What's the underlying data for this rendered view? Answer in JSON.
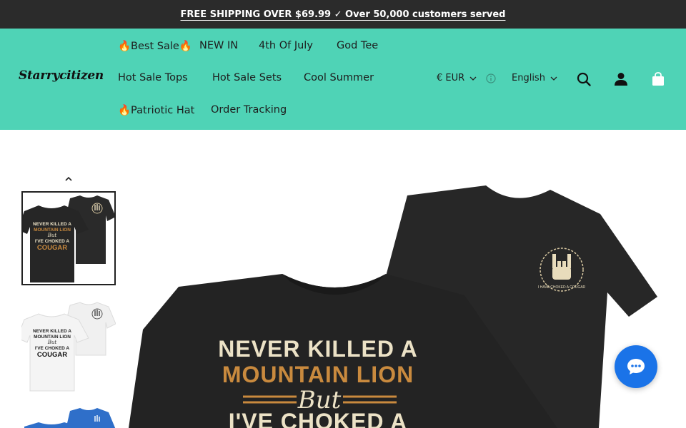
{
  "announcement": "FREE SHIPPING OVER $69.99 ✓ Over 50,000 customers served",
  "brand": {
    "logo_text": "Starrycitizen"
  },
  "nav": [
    {
      "label": "🔥Best Sale🔥"
    },
    {
      "label": "NEW IN"
    },
    {
      "label": "4th Of July"
    },
    {
      "label": "God Tee"
    },
    {
      "label": "Hot Sale Tops"
    },
    {
      "label": "Hot Sale Sets"
    },
    {
      "label": "Cool Summer"
    },
    {
      "label": "🔥Patriotic Hat"
    },
    {
      "label": "Order Tracking"
    }
  ],
  "utility": {
    "currency": "€ EUR",
    "language": "English"
  },
  "icons": {
    "currency_info": "info-icon",
    "search": "search-icon",
    "account": "account-icon",
    "cart": "cart-icon",
    "gallery_up": "chevron-up-icon",
    "chat": "chat-bubble-icon"
  },
  "product": {
    "print_lines": [
      "NEVER KILLED A",
      "MOUNTAIN LION",
      "But",
      "I'VE CHOKED A"
    ],
    "thumb_print_lines": [
      "NEVER KILLED A",
      "MOUNTAIN LION",
      "But",
      "I'VE CHOKED A",
      "COUGAR"
    ],
    "pocket_text": "I HAVE CHOKED A COUGAR",
    "thumbnails": [
      {
        "variant": "Black",
        "selected": true
      },
      {
        "variant": "White",
        "selected": false
      },
      {
        "variant": "Royal Blue",
        "selected": false
      }
    ]
  },
  "colors": {
    "announce_bg": "#2b2b2b",
    "header_bg": "#4fd3b6",
    "shirt_black": "#262626",
    "shirt_white": "#f2f2f2",
    "shirt_blue": "#2f6fc9",
    "print_cream": "#ece2c6",
    "print_orange": "#c98a3e",
    "chat_blue": "#1a73e8"
  }
}
